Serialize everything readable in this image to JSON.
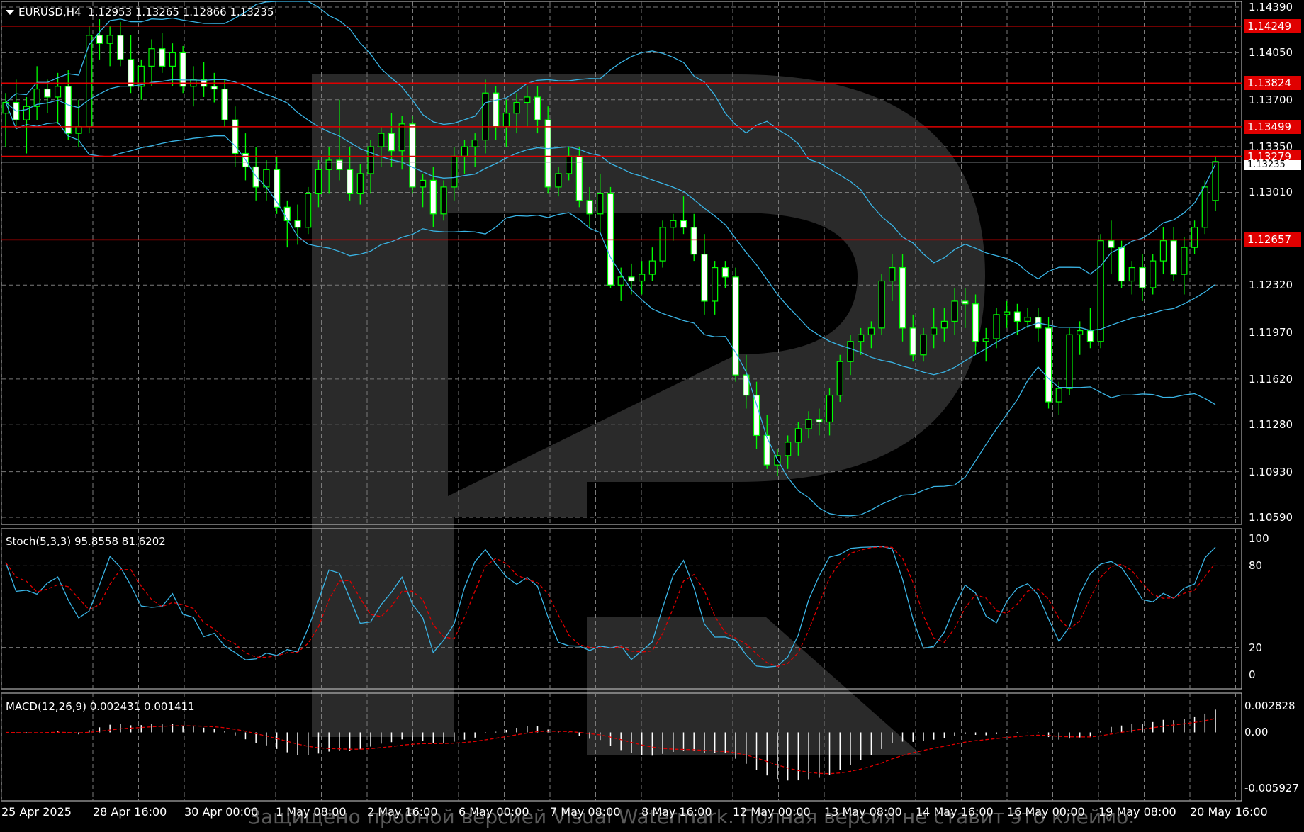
{
  "header": {
    "symbol": "EURUSD,H4",
    "ohlc": "1.12953 1.13265 1.12866 1.13235"
  },
  "price_axis": [
    "1.14390",
    "1.14050",
    "1.13700",
    "1.13350",
    "1.13010",
    "1.12320",
    "1.11970",
    "1.11620",
    "1.11280",
    "1.10930",
    "1.10590"
  ],
  "levels": [
    {
      "value": "1.14249",
      "price": 1.14249
    },
    {
      "value": "1.13824",
      "price": 1.13824
    },
    {
      "value": "1.13499",
      "price": 1.13499
    },
    {
      "value": "1.13279",
      "price": 1.13279
    },
    {
      "value": "1.12657",
      "price": 1.12657
    }
  ],
  "current_price": {
    "value": "1.13235",
    "price": 1.13235
  },
  "stoch": {
    "label": "Stoch(5,3,3) 95.8558 81.6202",
    "axis": [
      "100",
      "80",
      "20",
      "0"
    ]
  },
  "macd": {
    "label": "MACD(12,26,9) 0.002431 0.001411",
    "axis": [
      "0.002828",
      "0.00",
      "-0.005927"
    ]
  },
  "time_axis": [
    "25 Apr 2025",
    "28 Apr 16:00",
    "30 Apr 00:00",
    "1 May 08:00",
    "2 May 16:00",
    "6 May 00:00",
    "7 May 08:00",
    "8 May 16:00",
    "12 May 00:00",
    "13 May 08:00",
    "14 May 16:00",
    "16 May 00:00",
    "19 May 08:00",
    "20 May 16:00"
  ],
  "watermark": "Защищено пробной версией Visual Watermark. Полная версия не ставит это клеймо.",
  "colors": {
    "bull": "#00ff00",
    "bear": "#ffffff",
    "band": "#3ab5e6",
    "level": "#e00000",
    "signal": "#e00000",
    "grid": "#7a7a7a"
  },
  "chart_data": {
    "type": "candlestick",
    "series": [
      {
        "name": "EURUSD,H4",
        "values": [
          [
            1.136,
            1.1375,
            1.1335,
            1.1368
          ],
          [
            1.1368,
            1.1385,
            1.1348,
            1.1355
          ],
          [
            1.1355,
            1.1372,
            1.133,
            1.1365
          ],
          [
            1.1365,
            1.1395,
            1.1355,
            1.1378
          ],
          [
            1.1378,
            1.1385,
            1.136,
            1.1372
          ],
          [
            1.1372,
            1.139,
            1.1352,
            1.138
          ],
          [
            1.138,
            1.1392,
            1.134,
            1.1345
          ],
          [
            1.1345,
            1.137,
            1.1335,
            1.135
          ],
          [
            1.135,
            1.1425,
            1.1345,
            1.1418
          ],
          [
            1.1418,
            1.143,
            1.14,
            1.1412
          ],
          [
            1.1412,
            1.1425,
            1.1395,
            1.1418
          ],
          [
            1.1418,
            1.1428,
            1.1395,
            1.14
          ],
          [
            1.14,
            1.1418,
            1.1375,
            1.138
          ],
          [
            1.138,
            1.14,
            1.137,
            1.1395
          ],
          [
            1.1395,
            1.1415,
            1.138,
            1.1408
          ],
          [
            1.1408,
            1.142,
            1.139,
            1.1395
          ],
          [
            1.1395,
            1.1412,
            1.138,
            1.1405
          ],
          [
            1.1405,
            1.141,
            1.1375,
            1.138
          ],
          [
            1.138,
            1.1395,
            1.1365,
            1.1385
          ],
          [
            1.1385,
            1.1398,
            1.1372,
            1.138
          ],
          [
            1.138,
            1.139,
            1.1368,
            1.1378
          ],
          [
            1.1378,
            1.1385,
            1.135,
            1.1355
          ],
          [
            1.1355,
            1.1365,
            1.132,
            1.133
          ],
          [
            1.133,
            1.1345,
            1.131,
            1.132
          ],
          [
            1.132,
            1.1335,
            1.1295,
            1.1305
          ],
          [
            1.1305,
            1.1325,
            1.1295,
            1.1318
          ],
          [
            1.1318,
            1.1328,
            1.1285,
            1.129
          ],
          [
            1.129,
            1.1295,
            1.126,
            1.128
          ],
          [
            1.128,
            1.1292,
            1.1262,
            1.1275
          ],
          [
            1.1275,
            1.1305,
            1.127,
            1.13
          ],
          [
            1.13,
            1.1325,
            1.129,
            1.1318
          ],
          [
            1.1318,
            1.1335,
            1.13,
            1.1325
          ],
          [
            1.1325,
            1.137,
            1.131,
            1.1318
          ],
          [
            1.1318,
            1.1335,
            1.1295,
            1.13
          ],
          [
            1.13,
            1.1322,
            1.1292,
            1.1315
          ],
          [
            1.1315,
            1.134,
            1.13,
            1.1335
          ],
          [
            1.1335,
            1.135,
            1.132,
            1.1345
          ],
          [
            1.1345,
            1.136,
            1.132,
            1.1332
          ],
          [
            1.1332,
            1.1358,
            1.1318,
            1.1352
          ],
          [
            1.1352,
            1.1358,
            1.13,
            1.1305
          ],
          [
            1.1305,
            1.1315,
            1.129,
            1.131
          ],
          [
            1.131,
            1.132,
            1.1275,
            1.1285
          ],
          [
            1.1285,
            1.131,
            1.128,
            1.1305
          ],
          [
            1.1305,
            1.1335,
            1.1295,
            1.1328
          ],
          [
            1.1328,
            1.134,
            1.1315,
            1.1335
          ],
          [
            1.1335,
            1.1345,
            1.132,
            1.134
          ],
          [
            1.134,
            1.1385,
            1.133,
            1.1375
          ],
          [
            1.1375,
            1.138,
            1.134,
            1.135
          ],
          [
            1.135,
            1.137,
            1.1335,
            1.136
          ],
          [
            1.136,
            1.1375,
            1.1345,
            1.1368
          ],
          [
            1.1368,
            1.138,
            1.135,
            1.1372
          ],
          [
            1.1372,
            1.138,
            1.1345,
            1.1355
          ],
          [
            1.1355,
            1.1365,
            1.13,
            1.1305
          ],
          [
            1.1305,
            1.132,
            1.1298,
            1.1315
          ],
          [
            1.1315,
            1.1335,
            1.131,
            1.1328
          ],
          [
            1.1328,
            1.1335,
            1.129,
            1.1295
          ],
          [
            1.1295,
            1.1305,
            1.1275,
            1.1285
          ],
          [
            1.1285,
            1.1315,
            1.127,
            1.13
          ],
          [
            1.13,
            1.1305,
            1.123,
            1.1232
          ],
          [
            1.1232,
            1.1245,
            1.122,
            1.1238
          ],
          [
            1.1238,
            1.1248,
            1.1225,
            1.1235
          ],
          [
            1.1235,
            1.125,
            1.1225,
            1.124
          ],
          [
            1.124,
            1.126,
            1.1235,
            1.125
          ],
          [
            1.125,
            1.128,
            1.1245,
            1.1275
          ],
          [
            1.1275,
            1.1285,
            1.1265,
            1.128
          ],
          [
            1.128,
            1.1298,
            1.127,
            1.1275
          ],
          [
            1.1275,
            1.1285,
            1.125,
            1.1255
          ],
          [
            1.1255,
            1.127,
            1.121,
            1.122
          ],
          [
            1.122,
            1.125,
            1.121,
            1.1245
          ],
          [
            1.1245,
            1.125,
            1.123,
            1.1238
          ],
          [
            1.1238,
            1.1245,
            1.116,
            1.1165
          ],
          [
            1.1165,
            1.118,
            1.114,
            1.115
          ],
          [
            1.115,
            1.116,
            1.111,
            1.112
          ],
          [
            1.112,
            1.1135,
            1.1095,
            1.1098
          ],
          [
            1.1098,
            1.111,
            1.109,
            1.1105
          ],
          [
            1.1105,
            1.112,
            1.1095,
            1.1115
          ],
          [
            1.1115,
            1.113,
            1.1105,
            1.1125
          ],
          [
            1.1125,
            1.1138,
            1.1118,
            1.1132
          ],
          [
            1.1132,
            1.114,
            1.112,
            1.113
          ],
          [
            1.113,
            1.1155,
            1.112,
            1.115
          ],
          [
            1.115,
            1.118,
            1.1145,
            1.1175
          ],
          [
            1.1175,
            1.1195,
            1.1165,
            1.119
          ],
          [
            1.119,
            1.12,
            1.118,
            1.1195
          ],
          [
            1.1195,
            1.1205,
            1.1185,
            1.12
          ],
          [
            1.12,
            1.124,
            1.1195,
            1.1235
          ],
          [
            1.1235,
            1.1255,
            1.122,
            1.1245
          ],
          [
            1.1245,
            1.1255,
            1.119,
            1.12
          ],
          [
            1.12,
            1.121,
            1.1175,
            1.118
          ],
          [
            1.118,
            1.12,
            1.1175,
            1.1195
          ],
          [
            1.1195,
            1.1215,
            1.1185,
            1.12
          ],
          [
            1.12,
            1.1215,
            1.119,
            1.1205
          ],
          [
            1.1205,
            1.123,
            1.1195,
            1.122
          ],
          [
            1.122,
            1.123,
            1.12,
            1.1218
          ],
          [
            1.1218,
            1.1225,
            1.118,
            1.119
          ],
          [
            1.119,
            1.12,
            1.1175,
            1.1192
          ],
          [
            1.1192,
            1.1215,
            1.1185,
            1.121
          ],
          [
            1.121,
            1.122,
            1.12,
            1.1212
          ],
          [
            1.1212,
            1.1218,
            1.1195,
            1.1205
          ],
          [
            1.1205,
            1.1215,
            1.12,
            1.1208
          ],
          [
            1.1208,
            1.1215,
            1.119,
            1.12
          ],
          [
            1.12,
            1.1208,
            1.114,
            1.1145
          ],
          [
            1.1145,
            1.116,
            1.1135,
            1.1155
          ],
          [
            1.1155,
            1.12,
            1.115,
            1.1195
          ],
          [
            1.1195,
            1.1205,
            1.118,
            1.1198
          ],
          [
            1.1198,
            1.1215,
            1.1185,
            1.119
          ],
          [
            1.119,
            1.127,
            1.1185,
            1.1265
          ],
          [
            1.1265,
            1.128,
            1.124,
            1.126
          ],
          [
            1.126,
            1.1265,
            1.123,
            1.1235
          ],
          [
            1.1235,
            1.125,
            1.1225,
            1.1245
          ],
          [
            1.1245,
            1.1255,
            1.122,
            1.123
          ],
          [
            1.123,
            1.1255,
            1.1225,
            1.125
          ],
          [
            1.125,
            1.1275,
            1.124,
            1.1265
          ],
          [
            1.1265,
            1.1275,
            1.1235,
            1.124
          ],
          [
            1.124,
            1.1268,
            1.1225,
            1.126
          ],
          [
            1.126,
            1.128,
            1.1255,
            1.1275
          ],
          [
            1.1275,
            1.131,
            1.127,
            1.1305
          ],
          [
            1.1295,
            1.1328,
            1.1287,
            1.1324
          ]
        ]
      }
    ]
  }
}
